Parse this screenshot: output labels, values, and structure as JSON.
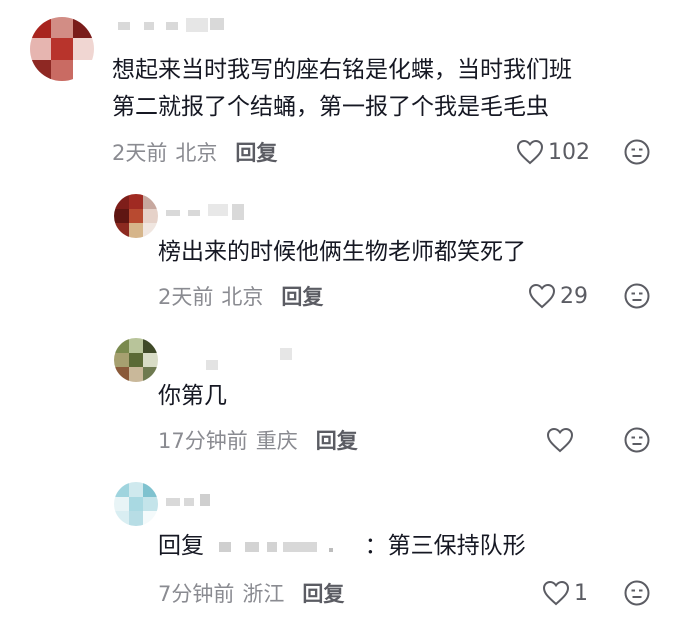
{
  "comments": [
    {
      "text_line1": "想起来当时我写的座右铭是化蝶，当时我们班",
      "text_line2": "第二就报了个结蛹，第一报了个我是毛毛虫",
      "time": "2天前",
      "location": "北京",
      "reply_label": "回复",
      "likes": "102",
      "avatar_colors": [
        "#a8241e",
        "#d28d85",
        "#7a1c1a",
        "#e6b5b0",
        "#b8342c",
        "#f0d6d2",
        "#8e2823",
        "#c96b63",
        "#ffffff"
      ]
    },
    {
      "text": "榜出来的时候他俩生物老师都笑死了",
      "time": "2天前",
      "location": "北京",
      "reply_label": "回复",
      "likes": "29",
      "avatar_colors": [
        "#7e1e1a",
        "#a02a22",
        "#c7a89f",
        "#5f1612",
        "#b84a30",
        "#e6d2c9",
        "#8c2a20",
        "#d6b58a",
        "#f0e6e0"
      ]
    },
    {
      "text": "你第几",
      "time": "17分钟前",
      "location": "重庆",
      "reply_label": "回复",
      "likes": "",
      "avatar_colors": [
        "#7a8a4e",
        "#b8c49a",
        "#3f4a28",
        "#a6a070",
        "#5b6a36",
        "#d8dcc6",
        "#8a5a3a",
        "#c9b89a",
        "#6e7a50"
      ]
    },
    {
      "text_prefix": "回复",
      "text_suffix": "：第三保持队形",
      "time": "7分钟前",
      "location": "浙江",
      "reply_label": "回复",
      "likes": "1",
      "avatar_colors": [
        "#9fd4de",
        "#cfe9ee",
        "#7fc2cf",
        "#e8f4f6",
        "#a9d9e2",
        "#c4e4ea",
        "#d9eef2",
        "#b7dde5",
        "#f4fafb"
      ]
    }
  ],
  "icons": {
    "like": "heart-outline-icon",
    "dislike": "unamused-face-icon"
  },
  "colors": {
    "text": "#161823",
    "meta": "#8a8b91",
    "reply": "#5b5c63"
  }
}
